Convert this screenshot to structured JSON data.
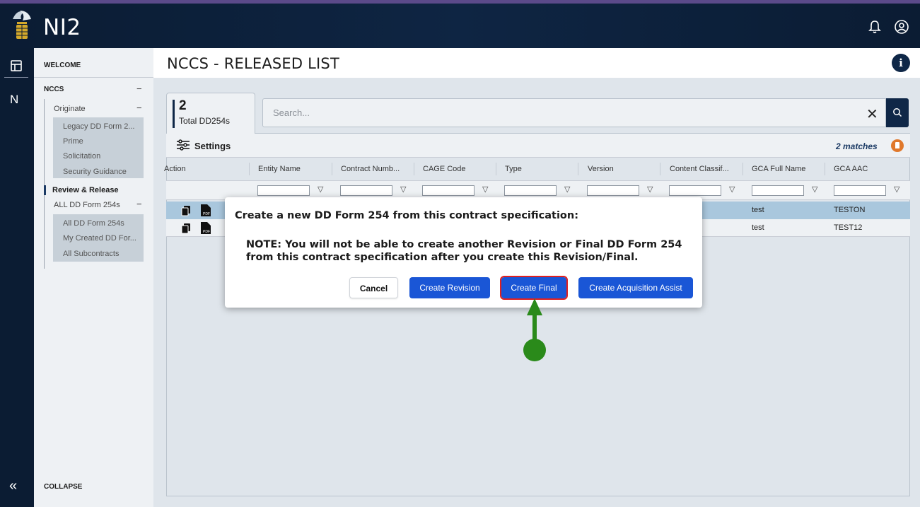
{
  "app": {
    "title": "NI2"
  },
  "rail": {
    "collapse_glyph": "«"
  },
  "sidebar": {
    "welcome": "WELCOME",
    "nccs": "NCCS",
    "originate": "Originate",
    "originate_items": [
      "Legacy DD Form 2...",
      "Prime",
      "Solicitation",
      "Security Guidance"
    ],
    "review_release": "Review & Release",
    "all_dd": "ALL DD Form 254s",
    "all_dd_items": [
      "All DD Form 254s",
      "My Created DD For...",
      "All Subcontracts"
    ],
    "collapse": "COLLAPSE"
  },
  "main": {
    "page_title": "NCCS - RELEASED LIST",
    "info_glyph": "i",
    "total_count": "2",
    "total_label": "Total DD254s",
    "search_placeholder": "Search...",
    "settings_label": "Settings",
    "matches": "2 matches",
    "columns": [
      "Action",
      "Entity Name",
      "Contract Numb...",
      "CAGE Code",
      "Type",
      "Version",
      "Content Classif...",
      "GCA Full Name",
      "GCA AAC"
    ],
    "rows": [
      {
        "gca_full_name": "test",
        "gca_aac": "TESTON",
        "selected": true
      },
      {
        "gca_full_name": "test",
        "gca_aac": "TEST12",
        "selected": false
      }
    ]
  },
  "modal": {
    "title": "Create a new DD Form 254 from this contract specification:",
    "note": "NOTE: You will not be able to create another Revision or Final DD Form 254 from this contract specification after you create this Revision/Final.",
    "cancel": "Cancel",
    "create_revision": "Create Revision",
    "create_final": "Create Final",
    "create_acquisition": "Create Acquisition Assist"
  },
  "icons": {
    "bell": "bell-icon",
    "user": "user-circle-icon",
    "dashboard": "dashboard-icon",
    "nav_n": "N",
    "settings": "sliders-icon",
    "search": "search-icon",
    "clear": "close-icon",
    "filter": "funnel-icon"
  },
  "colors": {
    "navy": "#0f2747",
    "primary_button": "#1a56d6",
    "highlight_outline": "#e02020",
    "annotation_green": "#2a8a1a",
    "selected_row": "#a9c7dd",
    "badge_orange": "#e0782b"
  }
}
